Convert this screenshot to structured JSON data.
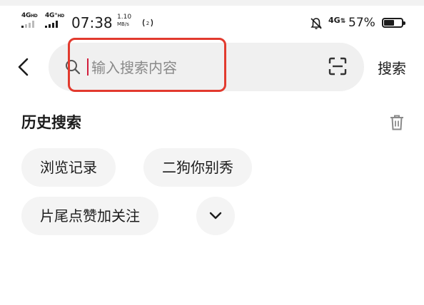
{
  "status_bar": {
    "sim1_network": "4G",
    "sim1_hd": "HD",
    "sim2_network": "4G⁺",
    "sim2_hd": "HD",
    "time": "07:38",
    "net_speed_value": "1.10",
    "net_speed_unit": "MB/s",
    "mobile_data": "4G",
    "battery_percent": "57%",
    "battery_level": 0.57,
    "icons": [
      "hotspot-icon",
      "bell-off-icon",
      "battery-icon"
    ]
  },
  "search": {
    "placeholder": "输入搜索内容",
    "value": "",
    "submit_label": "搜索",
    "icons": [
      "back-icon",
      "search-icon",
      "scan-icon"
    ],
    "highlight_color": "#e23a2e",
    "caret_color": "#d21e3c"
  },
  "history": {
    "title": "历史搜索",
    "clear_icon": "trash-icon",
    "items": [
      "浏览记录",
      "二狗你别秀",
      "片尾点赞加关注"
    ],
    "expand_icon": "chevron-down-icon"
  }
}
